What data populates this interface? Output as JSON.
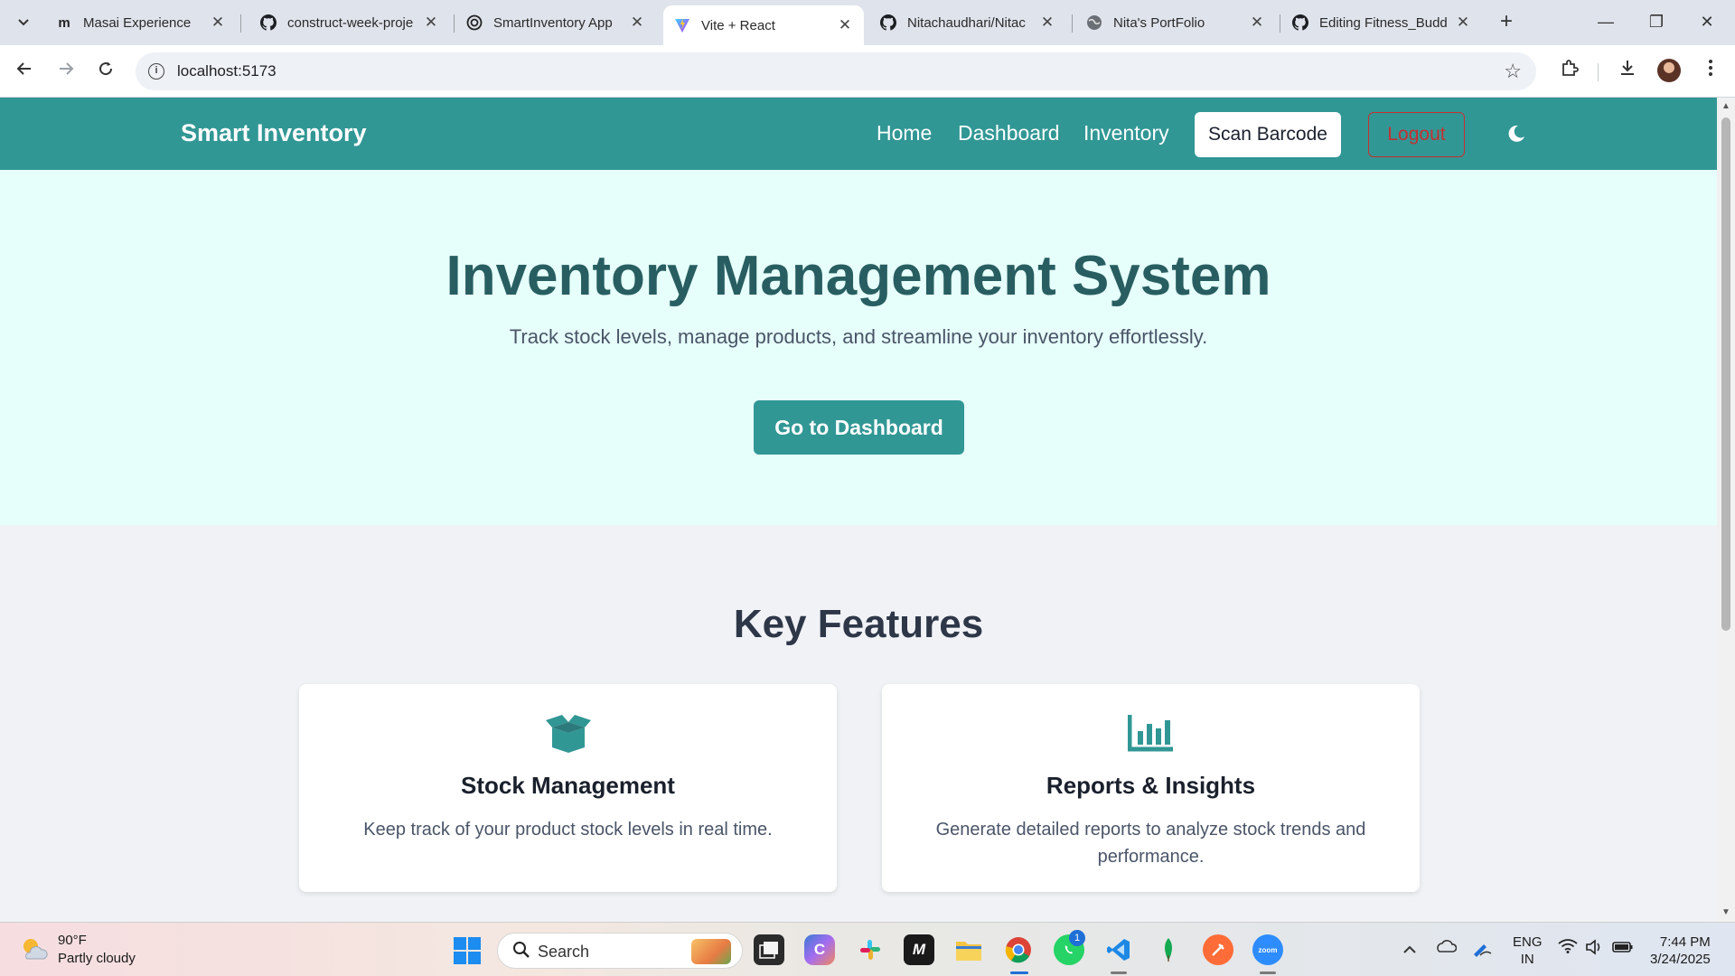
{
  "browser": {
    "tabs": [
      {
        "title": "Masai Experience",
        "favicon": "masai-icon",
        "active": false
      },
      {
        "title": "construct-week-proje",
        "favicon": "github-icon",
        "active": false
      },
      {
        "title": "SmartInventory App",
        "favicon": "openai-icon",
        "active": false
      },
      {
        "title": "Vite + React",
        "favicon": "vite-icon",
        "active": true
      },
      {
        "title": "Nitachaudhari/Nitac",
        "favicon": "github-icon",
        "active": false
      },
      {
        "title": "Nita's PortFolio",
        "favicon": "globe-icon",
        "active": false
      },
      {
        "title": "Editing Fitness_Budd",
        "favicon": "github-icon",
        "active": false
      }
    ],
    "url": "localhost:5173"
  },
  "navbar": {
    "brand": "Smart Inventory",
    "links": [
      "Home",
      "Dashboard",
      "Inventory"
    ],
    "scan_button": "Scan Barcode",
    "logout_button": "Logout",
    "theme_icon": "moon-icon"
  },
  "hero": {
    "title": "Inventory Management System",
    "subtitle": "Track stock levels, manage products, and streamline your inventory effortlessly.",
    "cta": "Go to Dashboard"
  },
  "features": {
    "heading": "Key Features",
    "cards": [
      {
        "icon": "box-open-icon",
        "title": "Stock Management",
        "description": "Keep track of your product stock levels in real time."
      },
      {
        "icon": "bar-chart-icon",
        "title": "Reports & Insights",
        "description": "Generate detailed reports to analyze stock trends and performance."
      }
    ]
  },
  "taskbar": {
    "weather_temp": "90°F",
    "weather_desc": "Partly cloudy",
    "search_label": "Search",
    "whatsapp_badge": "1",
    "lang_primary": "ENG",
    "lang_region": "IN",
    "time": "7:44 PM",
    "date": "3/24/2025"
  },
  "colors": {
    "primary": "#319795",
    "hero_bg": "#e6fffa",
    "hero_title": "#285e61",
    "logout": "#c53030"
  }
}
